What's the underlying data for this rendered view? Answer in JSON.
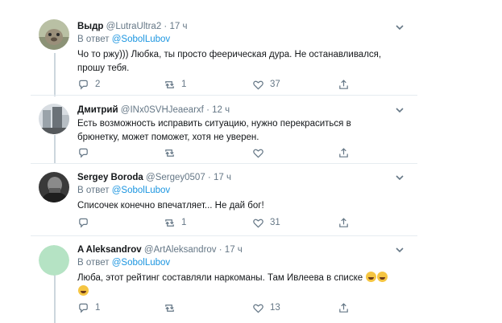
{
  "tweets": [
    {
      "name": "Выдр",
      "handle": "@LutraUltra2",
      "time": "17 ч",
      "reply_label": "В ответ",
      "reply_to": "@SobolLubov",
      "text_lines": [
        "Чо то ржу))) Любка, ты просто феерическая дура. Не останавливался,",
        "прошу тебя."
      ],
      "replies": "2",
      "retweets": "1",
      "likes": "37"
    },
    {
      "name": "Дмитрий",
      "handle": "@INx0SVHJeaearxf",
      "time": "12 ч",
      "text_lines": [
        "Есть возможность исправить ситуацию, нужно перекраситься в",
        "брюнетку, может поможет, хотя не уверен."
      ]
    },
    {
      "name": "Sergey Boroda",
      "handle": "@Sergey0507",
      "time": "17 ч",
      "reply_label": "В ответ",
      "reply_to": "@SobolLubov",
      "text_lines": [
        "Списочек конечно впечатляет... Не дай бог!"
      ],
      "retweets": "1",
      "likes": "31"
    },
    {
      "name": "A Aleksandrov",
      "handle": "@ArtAleksandrov",
      "time": "17 ч",
      "reply_label": "В ответ",
      "reply_to": "@SobolLubov",
      "text_lines": [
        "Люба, этот рейтинг составляли наркоманы. Там Ивлеева в списке"
      ],
      "emoji_name": "rolling-on-floor-laughing",
      "replies": "1",
      "likes": "13"
    }
  ],
  "dot": "·",
  "colors": {
    "text": "#14171a",
    "secondary": "#657786",
    "link": "#1b95e0",
    "border": "#e6ecf0",
    "thread": "#ccd6dd"
  },
  "icons": [
    "reply-icon",
    "retweet-icon",
    "like-icon",
    "share-icon",
    "chevron-down-icon"
  ]
}
